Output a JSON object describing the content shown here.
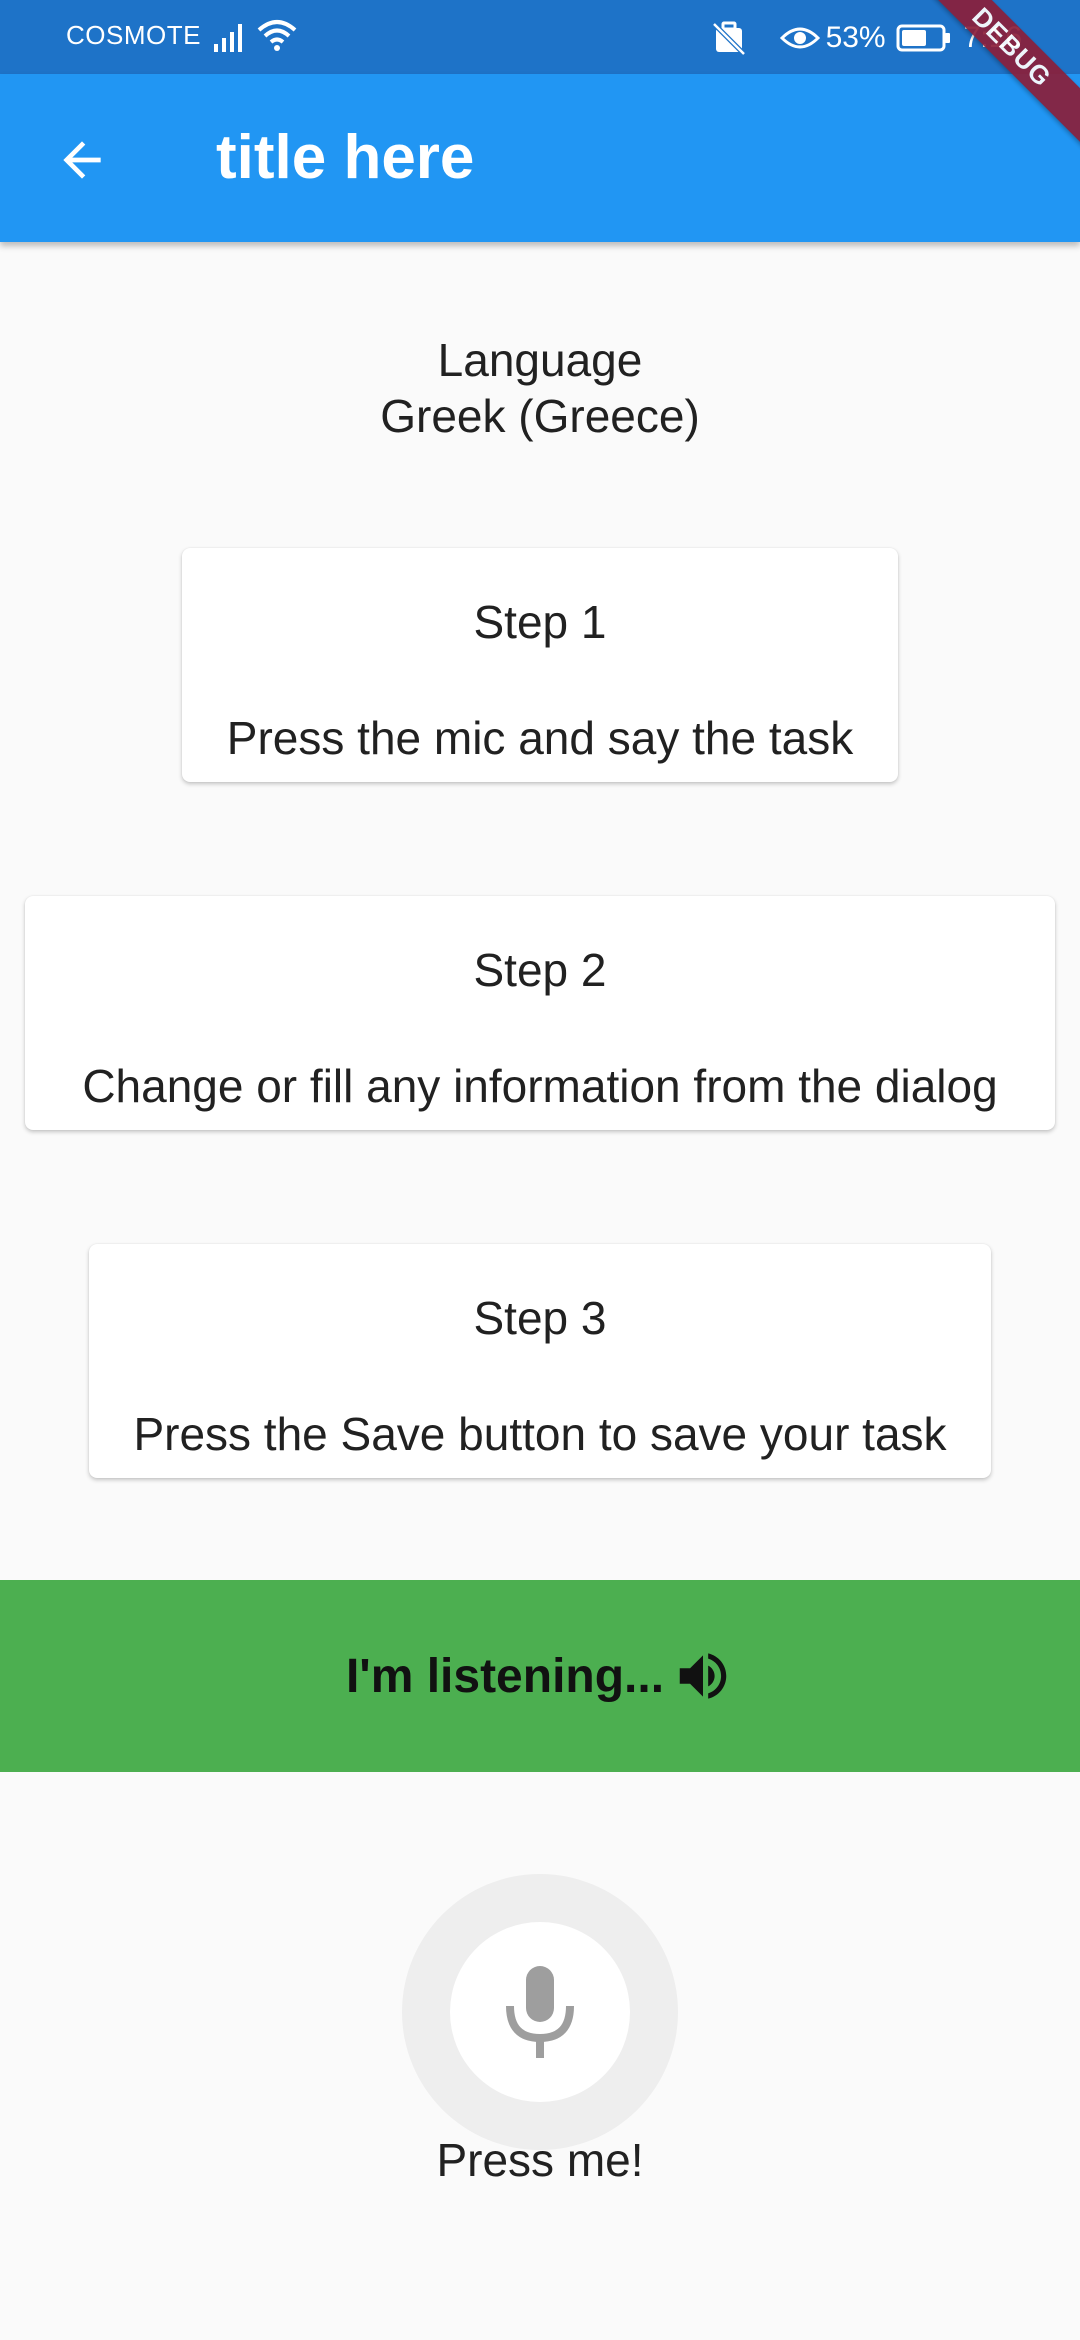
{
  "status_bar": {
    "carrier": "COSMOTE",
    "battery_percent": "53%",
    "time": "7:16",
    "icons": [
      "signal-icon",
      "wifi-icon",
      "no-sim-icon",
      "eye-icon",
      "battery-icon"
    ]
  },
  "debug_banner": "DEBUG",
  "app_bar": {
    "title": "title here",
    "back_icon": "arrow-back-icon",
    "color": "#2196f3"
  },
  "language": {
    "label": "Language",
    "value": "Greek (Greece)"
  },
  "steps": [
    {
      "title": "Step 1",
      "text": "Press the mic and say the task"
    },
    {
      "title": "Step 2",
      "text": "Change or fill any information from the dialog"
    },
    {
      "title": "Step 3",
      "text": "Press the Save button to save your task"
    }
  ],
  "listening": {
    "text": "I'm listening...",
    "icon": "speaker-icon",
    "color": "#4caf50"
  },
  "mic": {
    "icon": "mic-icon",
    "label": "Press me!"
  }
}
